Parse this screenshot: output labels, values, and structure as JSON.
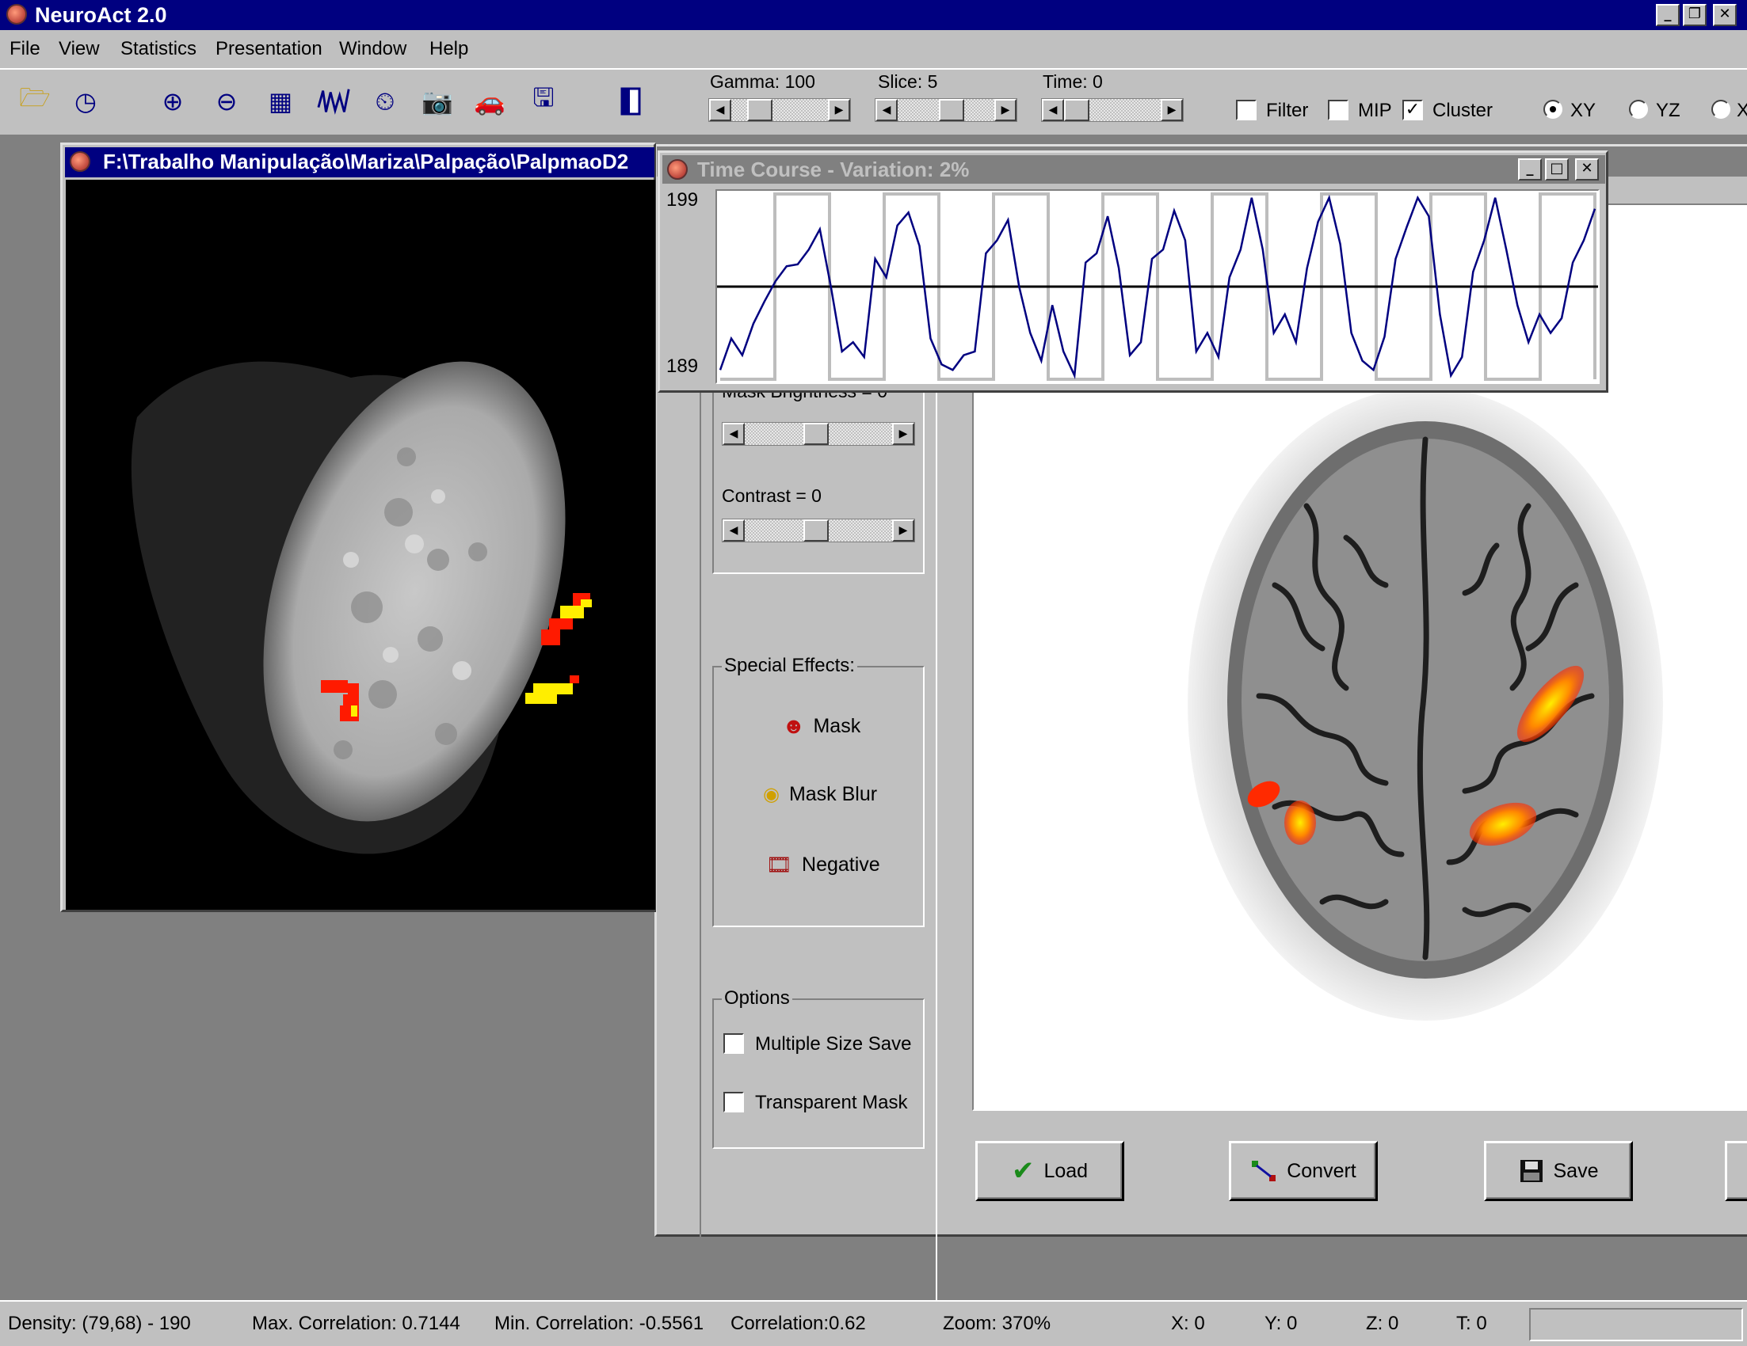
{
  "app": {
    "title": "NeuroAct 2.0"
  },
  "menu": [
    "File",
    "View",
    "Statistics",
    "Presentation",
    "Window",
    "Help"
  ],
  "toolbar": {
    "icons": [
      "open-folder-icon",
      "clock-icon",
      "zoom-in-icon",
      "zoom-out-icon",
      "grid-icon",
      "waveform-icon",
      "timer-icon",
      "camera-icon",
      "car-icon",
      "export-icon",
      "panel-icon"
    ],
    "gamma": {
      "label": "Gamma: 100",
      "value": 100
    },
    "slice": {
      "label": "Slice: 5",
      "value": 5
    },
    "time": {
      "label": "Time: 0",
      "value": 0
    },
    "options": [
      {
        "label": "Filter",
        "checked": false
      },
      {
        "label": "MIP",
        "checked": false
      },
      {
        "label": "Cluster",
        "checked": true
      }
    ],
    "planes": [
      {
        "label": "XY",
        "selected": true
      },
      {
        "label": "YZ",
        "selected": false
      },
      {
        "label": "X",
        "selected": false
      }
    ]
  },
  "image_window": {
    "title": "F:\\Trabalho Manipulação\\Mariza\\Palpação\\PalpmaoD2"
  },
  "time_course": {
    "title": "Time Course  - Variation: 2%",
    "ymax": "199",
    "ymin": "189",
    "signal": [
      189.5,
      191.2,
      190.3,
      192.0,
      193.2,
      194.3,
      195.1,
      195.2,
      196.0,
      197.1,
      194.0,
      190.5,
      191.0,
      190.2,
      195.5,
      194.5,
      197.3,
      198.0,
      196.2,
      191.2,
      189.8,
      189.5,
      190.3,
      190.5,
      195.8,
      196.5,
      197.6,
      194.0,
      191.5,
      190.0,
      193.0,
      190.5,
      189.2,
      195.3,
      195.8,
      197.8,
      195.0,
      190.3,
      191.0,
      195.5,
      196.0,
      198.1,
      196.5,
      190.5,
      191.5,
      190.2,
      194.5,
      196.0,
      198.8,
      196.0,
      191.5,
      192.5,
      191.0,
      195.0,
      197.5,
      198.8,
      196.3,
      191.5,
      190.0,
      189.5,
      191.3,
      195.5,
      197.2,
      198.8,
      197.8,
      192.5,
      189.2,
      190.2,
      194.8,
      196.5,
      198.8,
      196.0,
      193.0,
      191.0,
      192.5,
      191.5,
      192.3,
      195.3,
      196.5,
      198.2
    ],
    "baseline": 194.0,
    "boxcar_periods": 8
  },
  "convert_panel": {
    "mask_brightness_label": "Mask Brightness = 0",
    "contrast_label": "Contrast = 0",
    "special_effects_label": "Special Effects:",
    "effects": [
      {
        "label": "Mask",
        "icon": "mask-icon"
      },
      {
        "label": "Mask Blur",
        "icon": "mask-blur-icon"
      },
      {
        "label": "Negative",
        "icon": "film-icon"
      }
    ],
    "options_label": "Options",
    "options": [
      {
        "label": "Multiple Size Save",
        "checked": false
      },
      {
        "label": "Transparent Mask",
        "checked": false
      }
    ],
    "buttons": [
      {
        "label": "Load",
        "icon": "check-icon",
        "color": "#1a8a1a"
      },
      {
        "label": "Convert",
        "icon": "convert-icon",
        "color": "#1a8a1a"
      },
      {
        "label": "Save",
        "icon": "floppy-icon",
        "color": "#000000"
      }
    ]
  },
  "status": {
    "density": "Density: (79,68) - 190",
    "max_corr": "Max. Correlation: 0.7144",
    "min_corr": "Min. Correlation: -0.5561",
    "corr": "Correlation:0.62",
    "zoom": "Zoom: 370%",
    "x": "X: 0",
    "y": "Y: 0",
    "z": "Z: 0",
    "t": "T: 0"
  },
  "colors": {
    "titlebar": "#000080",
    "face": "#c0c0c0",
    "mdi": "#808080",
    "signal": "#000080",
    "activation_red": "#ff1a00",
    "activation_yellow": "#ffee00"
  }
}
